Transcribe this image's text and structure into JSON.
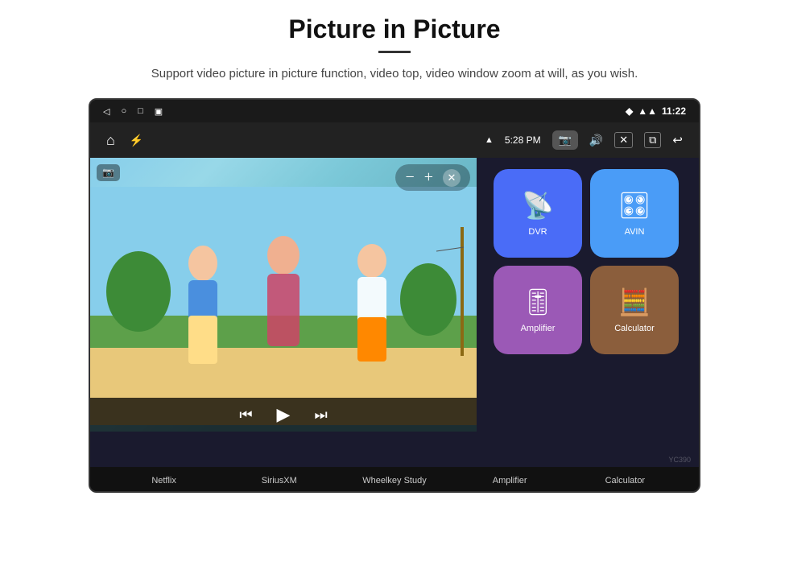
{
  "page": {
    "title": "Picture in Picture",
    "subtitle": "Support video picture in picture function, video top, video window zoom at will, as you wish.",
    "divider": "—"
  },
  "device": {
    "status_bar": {
      "left_icons": [
        "back-icon",
        "home-icon",
        "square-icon",
        "cast-icon"
      ],
      "right": {
        "wifi_icon": "wifi",
        "signal_icon": "signal",
        "time": "11:22"
      }
    },
    "nav_bar": {
      "home_icon": "⌂",
      "usb_icon": "⚡",
      "wifi_label": "5:28 PM",
      "camera_icon": "📷",
      "volume_icon": "🔊",
      "close_icon": "✕",
      "pip_icon": "⧉",
      "back_icon": "↩"
    },
    "apps": {
      "top_blobs": [
        {
          "color": "#4CAF50",
          "label": "green"
        },
        {
          "color": "#E91E8C",
          "label": "pink"
        },
        {
          "color": "#9C27B0",
          "label": "purple"
        }
      ],
      "right_icons": [
        {
          "id": "dvr",
          "label": "DVR",
          "color": "#4a6cf7",
          "symbol": "📡"
        },
        {
          "id": "avin",
          "label": "AVIN",
          "color": "#4a9cf7",
          "symbol": "🎛"
        },
        {
          "id": "amplifier",
          "label": "Amplifier",
          "color": "#9b59b6",
          "symbol": "🎚"
        },
        {
          "id": "calculator",
          "label": "Calculator",
          "color": "#8B5E3C",
          "symbol": "🧮"
        }
      ],
      "bottom_labels": [
        "Netflix",
        "SiriusXM",
        "Wheelkey Study",
        "Amplifier",
        "Calculator"
      ]
    },
    "pip": {
      "minus_label": "−",
      "plus_label": "+",
      "close_label": "✕",
      "rewind_label": "⏮",
      "play_label": "▶",
      "forward_label": "⏭"
    }
  }
}
